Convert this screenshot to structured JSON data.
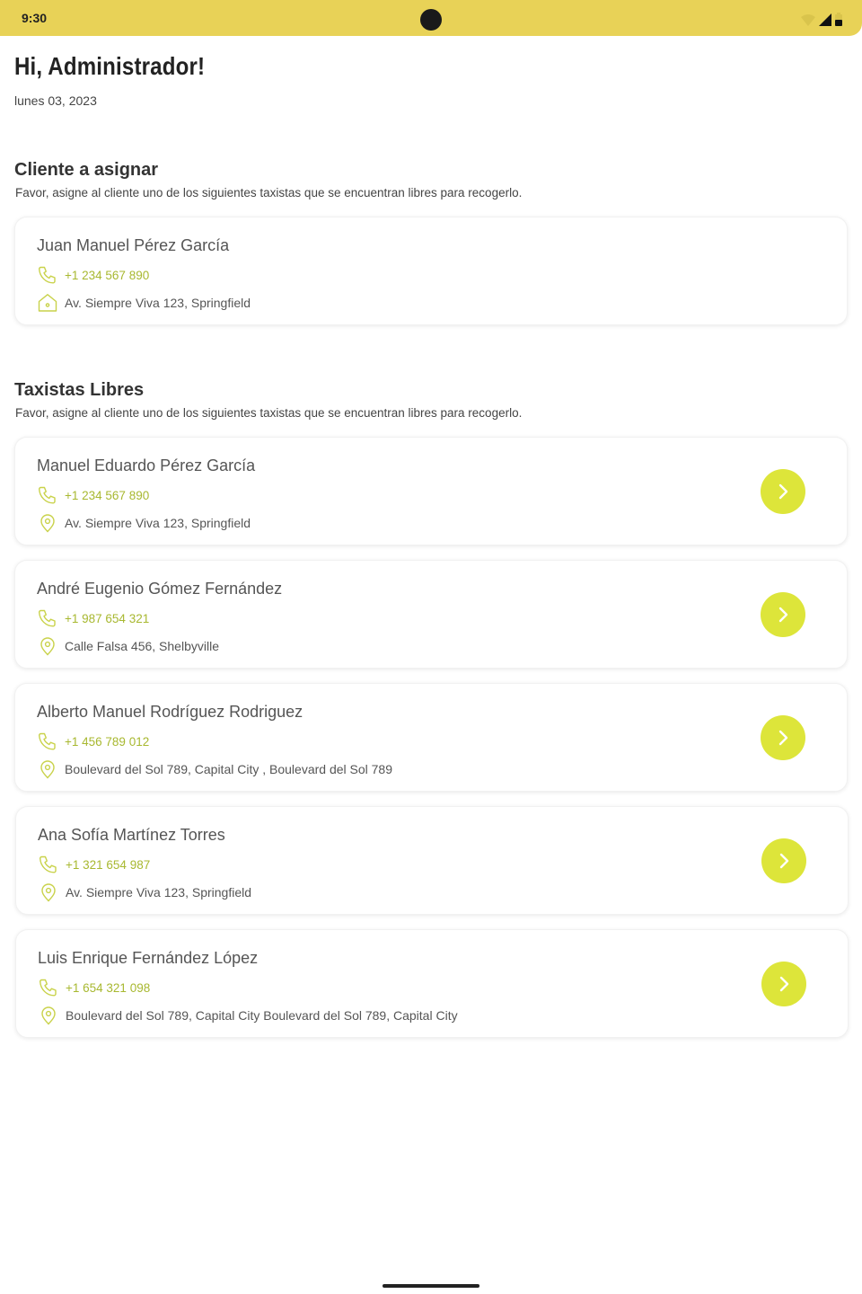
{
  "status": {
    "time": "9:30"
  },
  "header": {
    "greeting": "Hi, Administrador!",
    "date": "lunes 03, 2023"
  },
  "client_section": {
    "title": "Cliente a asignar",
    "description": "Favor, asigne al cliente uno de los siguientes taxistas que se encuentran libres para recogerlo.",
    "client": {
      "name": "Juan Manuel Pérez García",
      "phone": "+1 234 567 890",
      "address": "Av. Siempre Viva 123, Springfield"
    }
  },
  "drivers_section": {
    "title": "Taxistas Libres",
    "description": "Favor, asigne al cliente uno de los siguientes taxistas que se encuentran libres para recogerlo.",
    "drivers": [
      {
        "name": "Manuel Eduardo Pérez García",
        "phone": "+1 234 567 890",
        "address": "Av. Siempre Viva 123, Springfield"
      },
      {
        "name": "André Eugenio Gómez Fernández",
        "phone": "+1 987 654 321",
        "address": "Calle Falsa 456, Shelbyville"
      },
      {
        "name": "Alberto Manuel Rodríguez  Rodriguez",
        "phone": "+1 456 789 012",
        "address": "Boulevard del Sol 789, Capital City , Boulevard del Sol 789"
      },
      {
        "name": "Ana Sofía Martínez Torres",
        "phone": "+1 321 654 987",
        "address": "Av. Siempre Viva 123, Springfield"
      },
      {
        "name": "Luis Enrique Fernández López",
        "phone": "+1 654 321 098",
        "address": "Boulevard del Sol 789, Capital City Boulevard del Sol 789, Capital City"
      }
    ]
  },
  "colors": {
    "accent": "#dde53a",
    "status_bar": "#e8d257",
    "phone_text": "#a8b830",
    "icon_stroke": "#c9d24a"
  },
  "icons": {
    "phone": "phone-icon",
    "home": "home-icon",
    "location": "location-pin-icon",
    "action": "chevron-right-icon"
  }
}
